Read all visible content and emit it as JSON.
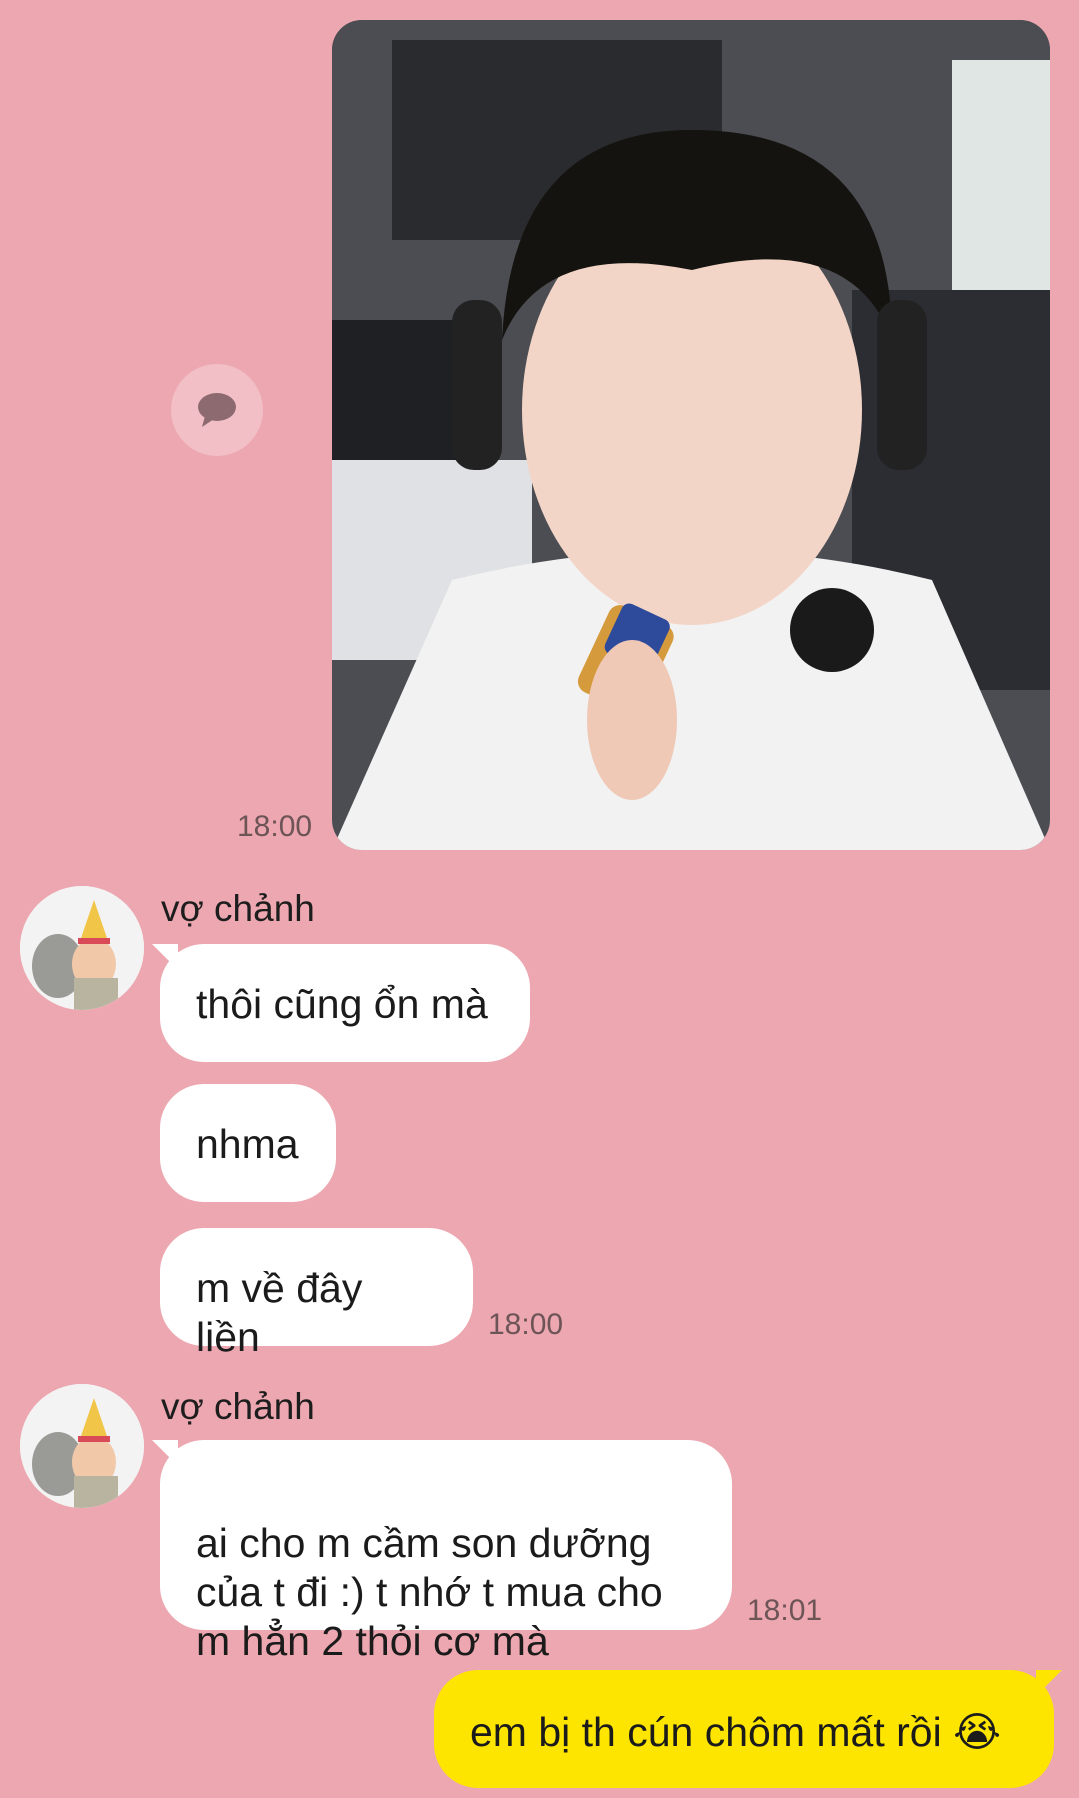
{
  "outgoing_photo": {
    "time": "18:00"
  },
  "incoming_group_1": {
    "sender": "vợ chảnh",
    "messages": [
      "thôi cũng ổn mà",
      "nhma",
      "m về đây liền"
    ],
    "time": "18:00"
  },
  "incoming_group_2": {
    "sender": "vợ chảnh",
    "messages": [
      "ai cho m cầm son dưỡng\ncủa t đi :) t nhớ t mua cho\nm hẳn 2 thỏi cơ mà"
    ],
    "time": "18:01"
  },
  "outgoing_message": {
    "text": "em bị th cún chôm mất rồi 😭"
  },
  "colors": {
    "background": "#EDA7B0",
    "incoming_bubble": "#FFFFFF",
    "outgoing_bubble": "#FEE500"
  }
}
